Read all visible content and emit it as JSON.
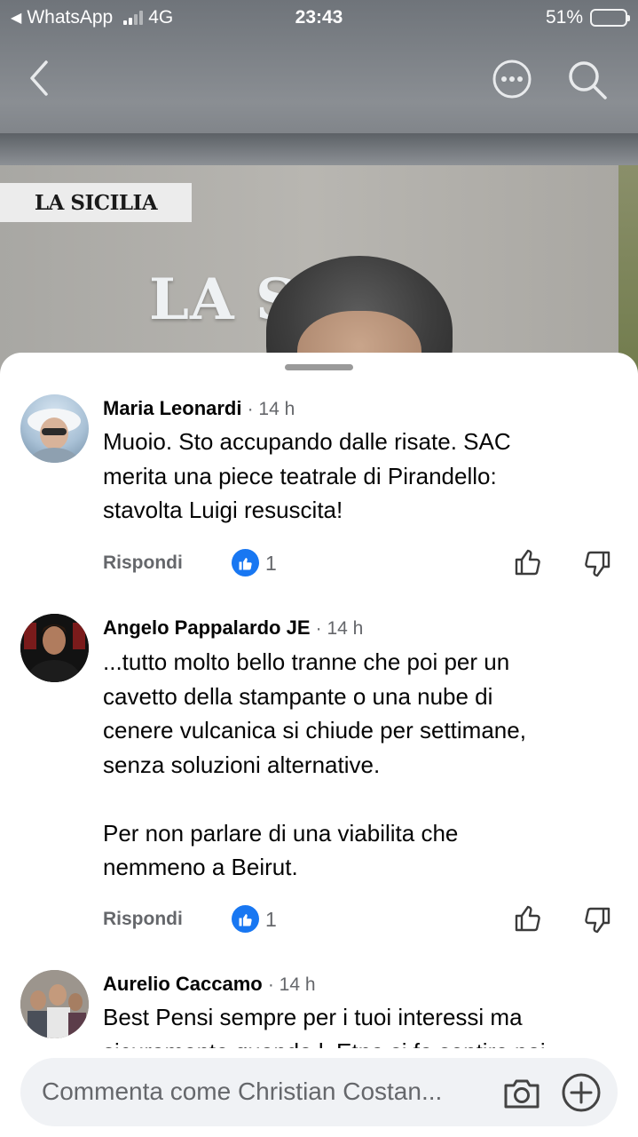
{
  "status_bar": {
    "back_app": "WhatsApp",
    "network": "4G",
    "time": "23:43",
    "battery": "51%",
    "battery_level": 0.51
  },
  "video": {
    "logo_plate": "LA SICILIA",
    "wall_sign": "LA SI  A"
  },
  "icons": {
    "back": "chevron-left-icon",
    "more": "more-horizontal-icon",
    "search": "search-icon",
    "like": "thumbs-up-icon",
    "dislike": "thumbs-down-icon",
    "camera": "camera-icon",
    "add": "plus-circle-icon"
  },
  "comments": [
    {
      "author": "Maria Leonardi",
      "time": "· 14 h",
      "text": "Muoio. Sto accupando dalle risate. SAC\nmerita una piece teatrale di Pirandello:\nstavolta Luigi resuscita!",
      "reply_label": "Rispondi",
      "likes": "1"
    },
    {
      "author": "Angelo Pappalardo JE",
      "time": "· 14 h",
      "text": "...tutto molto bello tranne che poi per un\ncavetto della stampante o una nube di\ncenere vulcanica si chiude per settimane,\nsenza soluzioni alternative.\n\nPer non parlare di una viabilita che\nnemmeno a Beirut.",
      "reply_label": "Rispondi",
      "likes": "1"
    },
    {
      "author": "Aurelio Caccamo",
      "time": "· 14 h",
      "text": "Best Pensi sempre per i tuoi interessi ma\nsicuramente quando l  Etna si fa sentire poi"
    }
  ],
  "composer": {
    "placeholder": "Commenta come Christian Costan..."
  },
  "colors": {
    "like_blue": "#1877f2",
    "battery_yellow": "#ffd60a",
    "secondary_text": "#65676b",
    "composer_bg": "#f0f2f5"
  }
}
